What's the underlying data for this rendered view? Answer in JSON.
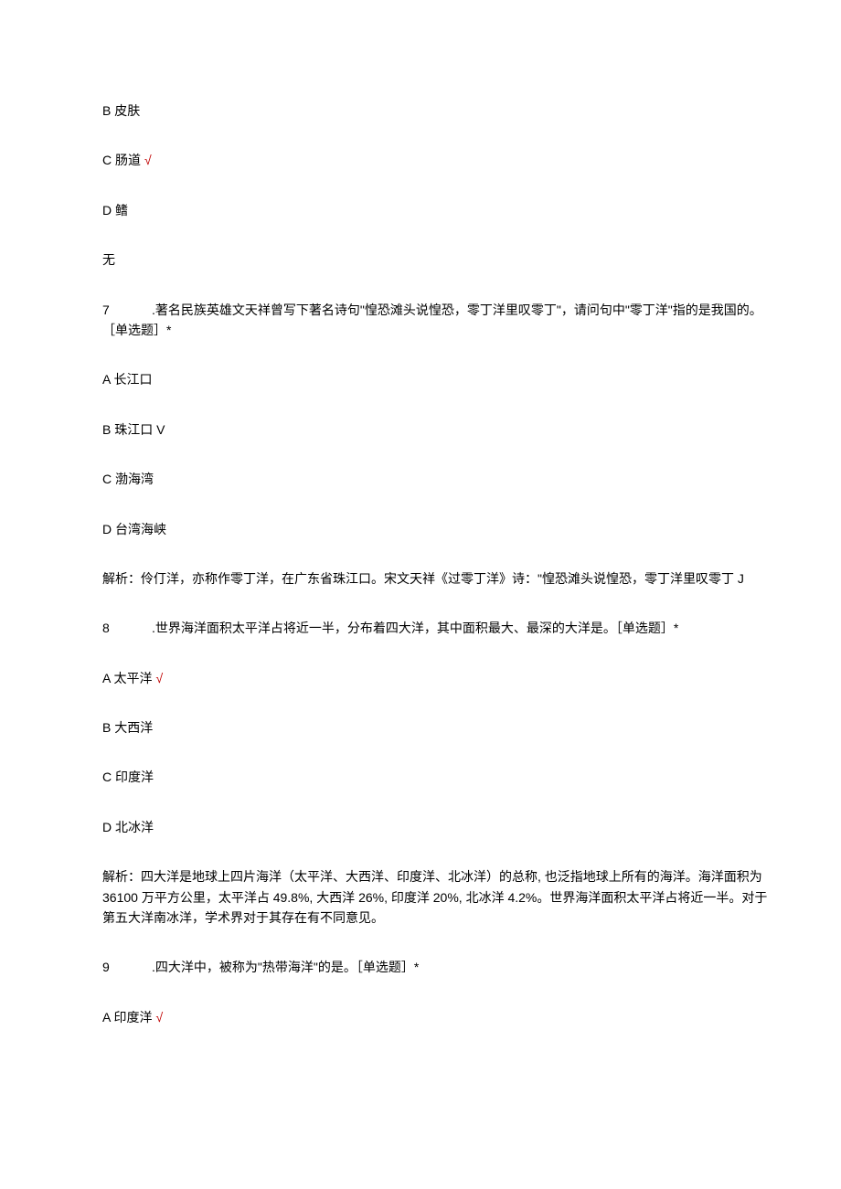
{
  "q6_options": {
    "B": "B 皮肤",
    "C": "C 肠道",
    "C_mark": "√",
    "D": "D 鳍",
    "none": "无"
  },
  "q7": {
    "num": "7",
    "text": ".著名民族英雄文天祥曾写下著名诗句\"惶恐滩头说惶恐，零丁洋里叹零丁\"，请问句中\"零丁洋\"指的是我国的。［单选题］*",
    "A": "A 长江口",
    "B": "B 珠江口 V",
    "C": "C 渤海湾",
    "D": "D 台湾海峡",
    "analysis": "解析：伶仃洋，亦称作零丁洋，在广东省珠江口。宋文天祥《过零丁洋》诗：\"惶恐滩头说惶恐，零丁洋里叹零丁 J"
  },
  "q8": {
    "num": "8",
    "text": ".世界海洋面积太平洋占将近一半，分布着四大洋，其中面积最大、最深的大洋是。［单选题］*",
    "A": "A 太平洋",
    "A_mark": "√",
    "B": "B 大西洋",
    "C": "C 印度洋",
    "D": "D 北冰洋",
    "analysis": "解析：四大洋是地球上四片海洋（太平洋、大西洋、印度洋、北冰洋）的总称, 也泛指地球上所有的海洋。海洋面积为 36100 万平方公里，太平洋占 49.8%, 大西洋 26%, 印度洋 20%, 北冰洋 4.2%。世界海洋面积太平洋占将近一半。对于第五大洋南冰洋，学术界对于其存在有不同意见。"
  },
  "q9": {
    "num": "9",
    "text": ".四大洋中，被称为\"热带海洋\"的是。［单选题］*",
    "A": "A 印度洋",
    "A_mark": "√"
  }
}
